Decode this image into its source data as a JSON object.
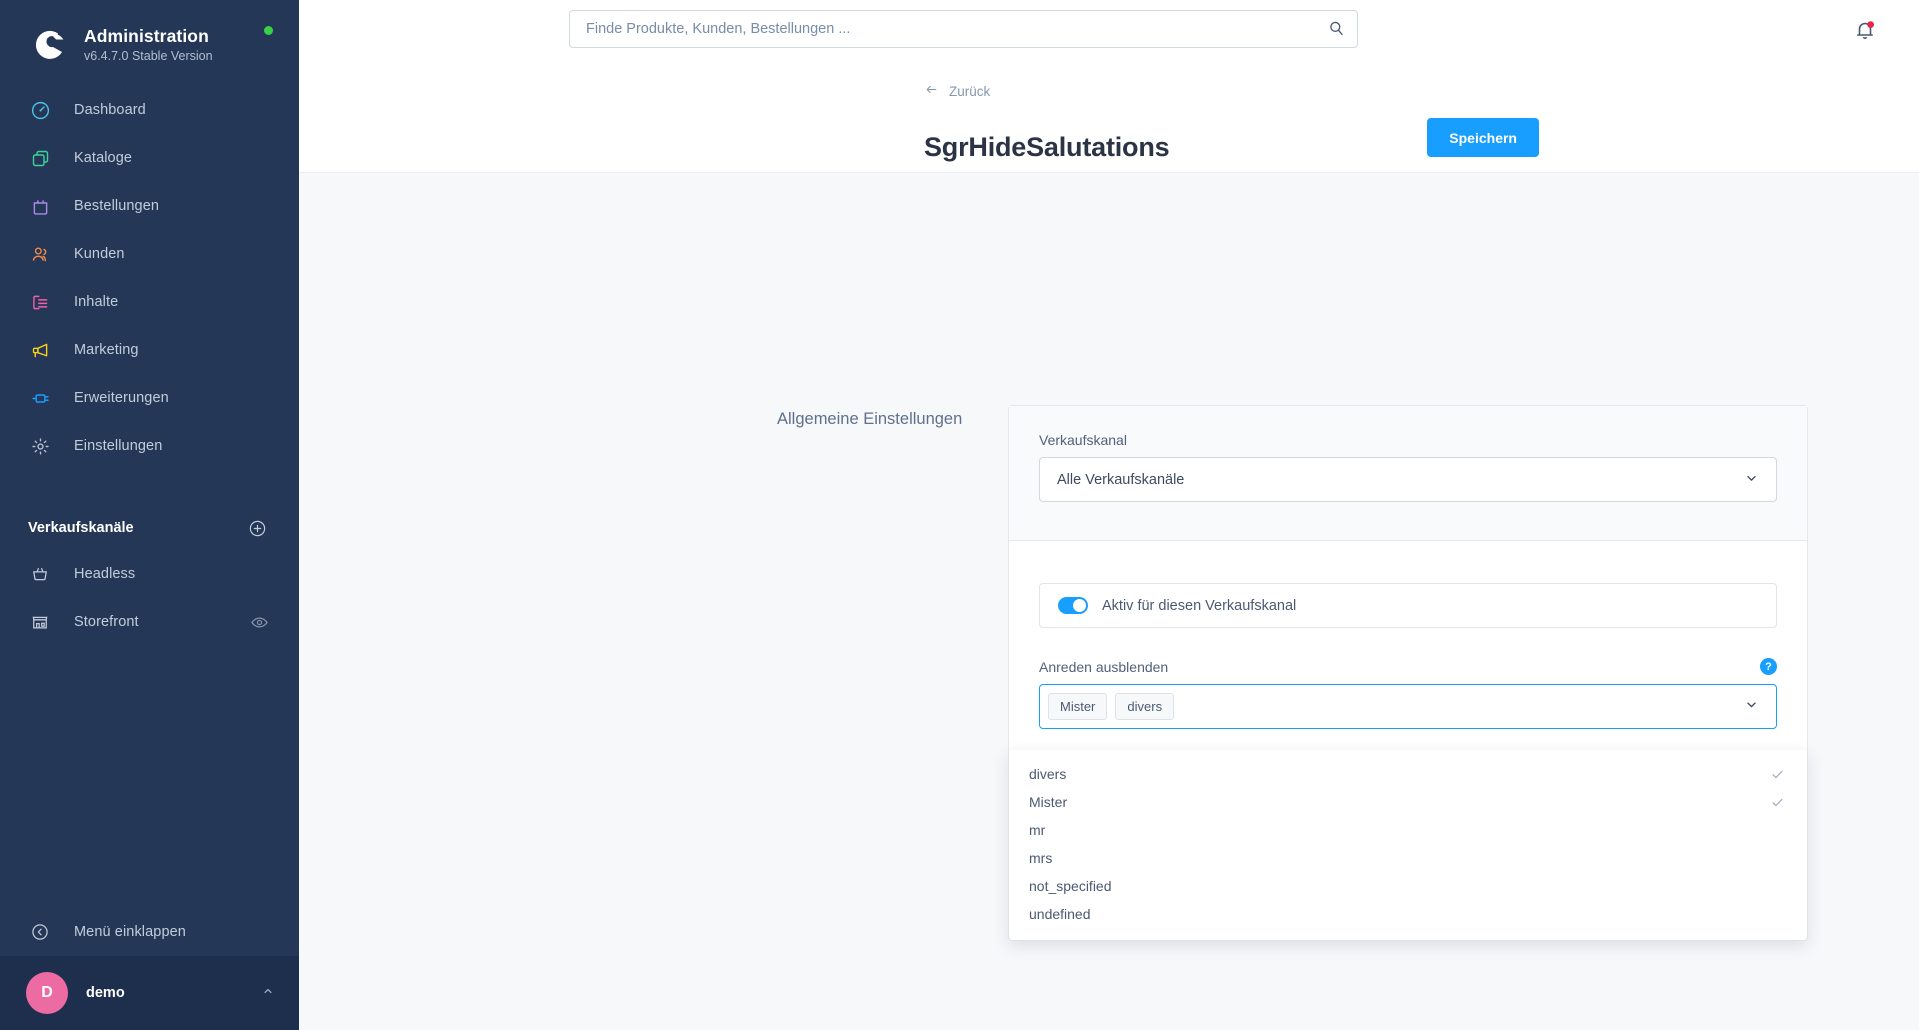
{
  "sidebar": {
    "brand": {
      "title": "Administration",
      "version": "v6.4.7.0 Stable Version",
      "logo_icon": "shopware-logo-icon",
      "status_dot_color": "#37d046"
    },
    "nav_items": [
      {
        "label": "Dashboard",
        "icon": "dashboard-icon",
        "color": "#4fc3e8"
      },
      {
        "label": "Kataloge",
        "icon": "catalogue-icon",
        "color": "#3ed29b"
      },
      {
        "label": "Bestellungen",
        "icon": "orders-bag-icon",
        "color": "#a98ce8"
      },
      {
        "label": "Kunden",
        "icon": "customers-icon",
        "color": "#f08a4b"
      },
      {
        "label": "Inhalte",
        "icon": "content-icon",
        "color": "#f060a8"
      },
      {
        "label": "Marketing",
        "icon": "megaphone-icon",
        "color": "#fbd014"
      },
      {
        "label": "Erweiterungen",
        "icon": "plugin-icon",
        "color": "#189eff"
      },
      {
        "label": "Einstellungen",
        "icon": "gear-icon",
        "color": "#b6bfcc"
      }
    ],
    "sales_channels": {
      "section_title": "Verkaufskanäle",
      "add_icon": "plus-circle-icon",
      "items": [
        {
          "label": "Headless",
          "icon": "basket-icon",
          "trailing_icon": ""
        },
        {
          "label": "Storefront",
          "icon": "store-icon",
          "trailing_icon": "eye-icon"
        }
      ]
    },
    "collapse": {
      "label": "Menü einklappen",
      "icon": "collapse-left-icon"
    },
    "user": {
      "name": "demo",
      "initial": "D",
      "avatar_color": "#ed6ba3",
      "caret_icon": "chevron-up-icon"
    }
  },
  "topbar": {
    "search_placeholder": "Finde Produkte, Kunden, Bestellungen ...",
    "search_value": "",
    "search_icon": "search-icon",
    "notification_icon": "bell-icon",
    "notification_badge_color": "#e5254a"
  },
  "page_header": {
    "back_label": "Zurück",
    "back_icon": "arrow-left-icon",
    "title": "SgrHideSalutations",
    "save_label": "Speichern",
    "save_color": "#189eff"
  },
  "content": {
    "section_label": "Allgemeine Einstellungen",
    "sales_channel": {
      "label": "Verkaufskanal",
      "value": "Alle Verkaufskanäle",
      "chevron_icon": "chevron-down-icon"
    },
    "active_switch": {
      "label": "Aktiv für diesen Verkaufskanal",
      "checked": true
    },
    "salutations_field": {
      "label": "Anreden ausblenden",
      "help_icon": "question-mark-icon",
      "help_label": "?",
      "chevron_icon": "chevron-down-icon",
      "selected_tags": [
        "Mister",
        "divers"
      ],
      "options": [
        {
          "label": "divers",
          "selected": true
        },
        {
          "label": "Mister",
          "selected": true
        },
        {
          "label": "mr",
          "selected": false
        },
        {
          "label": "mrs",
          "selected": false
        },
        {
          "label": "not_specified",
          "selected": false
        },
        {
          "label": "undefined",
          "selected": false
        }
      ],
      "check_icon": "check-icon"
    }
  }
}
